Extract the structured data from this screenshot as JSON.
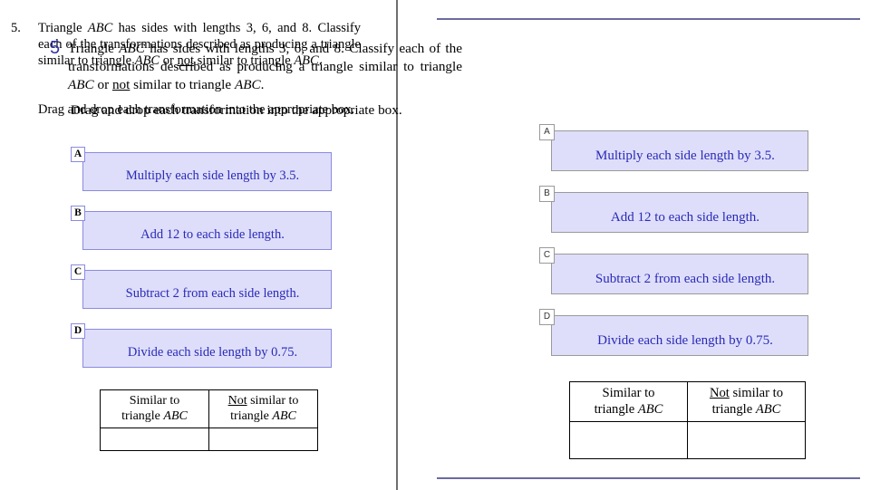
{
  "left_panel": {
    "question_number": "5.",
    "stem_parts": {
      "p1": "Triangle ",
      "abc1": "ABC",
      "p2": " has sides with lengths 3, 6, and 8. Classify each of the transformations described as producing a triangle similar to triangle ",
      "abc2": "ABC",
      "p3": " or ",
      "not": "not",
      "p4": " similar to triangle ",
      "abc3": "ABC",
      "p5": "."
    },
    "instruction": "Drag and drop each transformation into the appropriate box.",
    "options": [
      {
        "tag": "A",
        "text": "Multiply each side length by 3.5."
      },
      {
        "tag": "B",
        "text": "Add 12 to each side length."
      },
      {
        "tag": "C",
        "text": "Subtract 2 from each side length."
      },
      {
        "tag": "D",
        "text": "Divide each side length by 0.75."
      }
    ],
    "answer_table": {
      "headers": [
        {
          "line1": "Similar to",
          "line2_pre": "triangle ",
          "line2_abc": "ABC",
          "underline_word": ""
        },
        {
          "line1_not": "Not",
          "line1_rest": " similar to",
          "line2_pre": "triangle ",
          "line2_abc": "ABC"
        }
      ],
      "drop_cells": [
        "",
        ""
      ]
    }
  },
  "right_panel": {
    "question_number": "5",
    "stem_parts": {
      "p1": "Triangle ",
      "abc1": "ABC",
      "p2": " has sides with lengths 3, 6, and 8. Classify each of the transformations described as producing a triangle similar to triangle ",
      "abc2": "ABC",
      "p3": " or ",
      "not": "not",
      "p4": " similar to triangle ",
      "abc3": "ABC",
      "p5": "."
    },
    "instruction": "Drag and drop each transformation into the appropriate box.",
    "options": [
      {
        "tag": "A",
        "text": "Multiply each side length by 3.5."
      },
      {
        "tag": "B",
        "text": "Add 12 to each side length."
      },
      {
        "tag": "C",
        "text": "Subtract 2 from each side length."
      },
      {
        "tag": "D",
        "text": "Divide each side length by 0.75."
      }
    ],
    "answer_table": {
      "headers": [
        {
          "line1": "Similar to",
          "line2_pre": "triangle ",
          "line2_abc": "ABC"
        },
        {
          "line1_not": "Not",
          "line1_rest": " similar to",
          "line2_pre": "triangle ",
          "line2_abc": "ABC"
        }
      ],
      "drop_cells": [
        "",
        ""
      ]
    }
  },
  "colors": {
    "option_fill": "#dedefa",
    "option_text": "#2a2ab8",
    "left_option_border": "#8a8ae0",
    "right_option_border": "#9a9a9a",
    "rule": "#6b6b9e",
    "right_number": "#3333aa",
    "divider": "#6f6f6f"
  }
}
